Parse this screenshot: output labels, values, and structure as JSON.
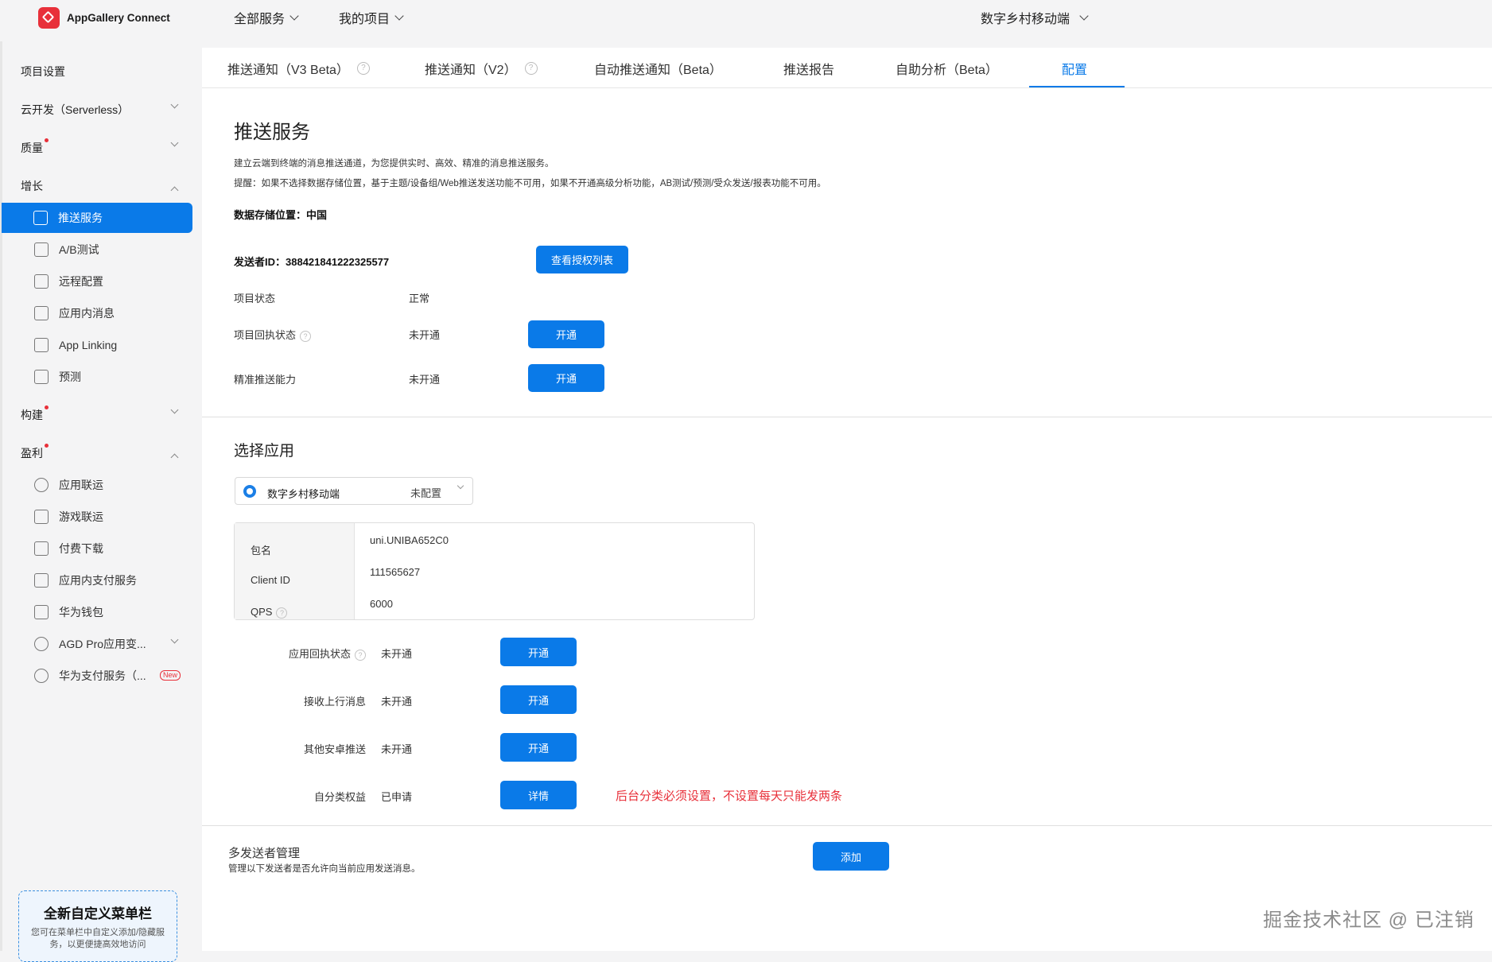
{
  "app": {
    "logo_text": "AppGallery Connect"
  },
  "topnav": {
    "all_services": "全部服务",
    "my_projects": "我的项目",
    "current_project": "数字乡村移动端"
  },
  "sidebar": {
    "project_settings": "项目设置",
    "serverless": "云开发（Serverless）",
    "quality": "质量",
    "growth": "增长",
    "growth_items": [
      "推送服务",
      "A/B测试",
      "远程配置",
      "应用内消息",
      "App Linking",
      "预测"
    ],
    "build": "构建",
    "earn": "盈利",
    "earn_items": [
      "应用联运",
      "游戏联运",
      "付费下载",
      "应用内支付服务",
      "华为钱包",
      "AGD Pro应用变...",
      "华为支付服务（..."
    ],
    "new_badge": "New",
    "promo_title": "全新自定义菜单栏",
    "promo_desc": "您可在菜单栏中自定义添加/隐藏服务，以更便捷高效地访问"
  },
  "tabs": [
    "推送通知（V3 Beta）",
    "推送通知（V2）",
    "自动推送通知（Beta）",
    "推送报告",
    "自助分析（Beta）",
    "配置"
  ],
  "tab_help": "?",
  "push": {
    "title": "推送服务",
    "desc1": "建立云端到终端的消息推送通道，为您提供实时、高效、精准的消息推送服务。",
    "desc2": "提醒：如果不选择数据存储位置，基于主题/设备组/Web推送发送功能不可用，如果不开通高级分析功能，AB测试/预测/受众发送/报表功能不可用。",
    "storage": "数据存储位置：中国",
    "sender_id": "发送者ID：388421841222325577",
    "view_auth_button": "查看授权列表",
    "project_status_label": "项目状态",
    "project_status_value": "正常",
    "receipt_label": "项目回执状态",
    "receipt_value": "未开通",
    "precise_label": "精准推送能力",
    "precise_value": "未开通",
    "enable_button": "开通"
  },
  "select_app": {
    "title": "选择应用",
    "app_name": "数字乡村移动端",
    "app_state": "未配置",
    "info": [
      {
        "key": "包名",
        "value": "uni.UNIBA652C0"
      },
      {
        "key": "Client ID",
        "value": "111565627"
      },
      {
        "key": "QPS",
        "value": "6000"
      }
    ],
    "rows": [
      {
        "label": "应用回执状态",
        "value": "未开通",
        "button": "开通"
      },
      {
        "label": "接收上行消息",
        "value": "未开通",
        "button": "开通"
      },
      {
        "label": "其他安卓推送",
        "value": "未开通",
        "button": "开通"
      },
      {
        "label": "自分类权益",
        "value": "已申请",
        "button": "详情"
      }
    ],
    "warning": "后台分类必须设置，不设置每天只能发两条"
  },
  "multi_sender": {
    "title": "多发送者管理",
    "desc": "管理以下发送者是否允许向当前应用发送消息。",
    "add_button": "添加"
  },
  "watermark": "掘金技术社区 @ 已注销",
  "colors": {
    "accent": "#0a7ae8",
    "brand_red": "#e8303a"
  }
}
